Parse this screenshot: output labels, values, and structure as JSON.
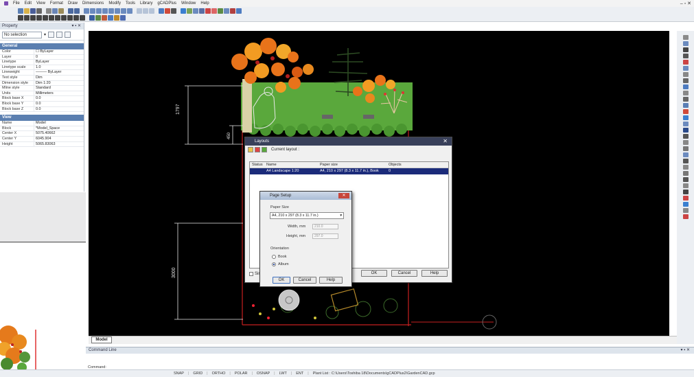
{
  "menu": {
    "items": [
      "File",
      "Edit",
      "View",
      "Format",
      "Draw",
      "Dimensions",
      "Modify",
      "Tools",
      "Library",
      "gCADPlus",
      "Window",
      "Help"
    ],
    "window_controls": "– ▫ ✕"
  },
  "property_panel": {
    "title": "Property",
    "title_controls": "▾ ▪ ✕",
    "selection": "No selection",
    "general_header": "General",
    "general": [
      {
        "k": "Color",
        "v": "☐ ByLayer"
      },
      {
        "k": "Layer",
        "v": "0"
      },
      {
        "k": "Linetype",
        "v": "ByLayer"
      },
      {
        "k": "Linetype scale",
        "v": "1.0"
      },
      {
        "k": "Lineweight",
        "v": "——— ByLayer"
      },
      {
        "k": "Text style",
        "v": "Dim"
      },
      {
        "k": "Dimension style",
        "v": "Dim 1:20"
      },
      {
        "k": "Mline style",
        "v": "Standard"
      },
      {
        "k": "Units",
        "v": "Millimeters"
      },
      {
        "k": "Block base X",
        "v": "0.0"
      },
      {
        "k": "Block base Y",
        "v": "0.0"
      },
      {
        "k": "Block base Z",
        "v": "0.0"
      }
    ],
    "view_header": "View",
    "view": [
      {
        "k": "Name",
        "v": "Model"
      },
      {
        "k": "Block",
        "v": "*Model_Space"
      },
      {
        "k": "Center X",
        "v": "5075.40662"
      },
      {
        "k": "Center Y",
        "v": "6045.904"
      },
      {
        "k": "Height",
        "v": "5065.83063"
      }
    ]
  },
  "drawing": {
    "dim1": "1797",
    "dim2": "450",
    "dim3": "3000"
  },
  "layouts_dialog": {
    "title": "Layouts",
    "current_layout_label": "Current layout :",
    "columns": [
      "Status",
      "Name",
      "Paper size",
      "Objects"
    ],
    "rows": [
      {
        "status": "",
        "name": "A4 Landscape 1:20",
        "paper": "A4, 210 x 297 (8.3 x 11.7 in.), Book",
        "objects": "0"
      }
    ],
    "ok": "OK",
    "cancel": "Cancel",
    "help": "Help",
    "footer_checkbox": "Sim"
  },
  "page_setup": {
    "title": "Page Setup",
    "paper_size_label": "Paper Size",
    "paper_size_value": "A4,  210 x 297 (8.3 x 11.7 in.)",
    "width_label": "Width, mm",
    "width_value": "210.0",
    "height_label": "Height, mm",
    "height_value": "297.0",
    "orientation_label": "Orientation",
    "book": "Book",
    "album": "Album",
    "ok": "OK",
    "cancel": "Cancel",
    "help": "Help"
  },
  "tabs": {
    "model": "Model"
  },
  "command": {
    "title": "Command Line",
    "title_controls": "▾ ▪ ✕",
    "prompt": "Command:"
  },
  "status": {
    "items": [
      "SNAP",
      "GRID",
      "ORTHO",
      "POLAR",
      "OSNAP",
      "LWT",
      "ENT"
    ],
    "plant_list": "Plant List : C:\\Users\\Toshiba 18\\Documents\\gCADPlus2\\GardenCAD.gcp"
  },
  "colors": {
    "canvas": "#000000",
    "hedge": "#5aa83c",
    "orange": "#e8731a",
    "selection": "#1b2b7a"
  }
}
